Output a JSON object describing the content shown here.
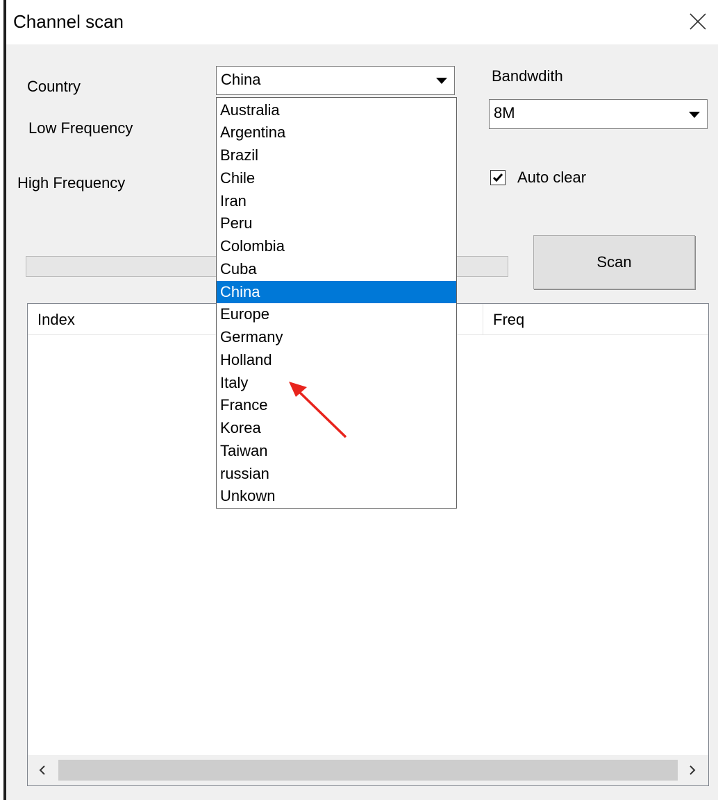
{
  "window": {
    "title": "Channel scan",
    "close_icon": "close-icon"
  },
  "form": {
    "country_label": "Country",
    "low_freq_label": "Low Frequency",
    "high_freq_label": "High Frequency",
    "bandwidth_label": "Bandwdith",
    "country_value": "China",
    "bandwidth_value": "8M",
    "auto_clear_label": "Auto clear",
    "auto_clear_checked": true,
    "scan_label": "Scan"
  },
  "country_dropdown": {
    "items": [
      "Australia",
      "Argentina",
      "Brazil",
      "Chile",
      "Iran",
      "Peru",
      "Colombia",
      "Cuba",
      "China",
      "Europe",
      "Germany",
      "Holland",
      "Italy",
      "France",
      "Korea",
      "Taiwan",
      "russian",
      "Unkown"
    ],
    "selected": "China"
  },
  "progress": {
    "value": 0
  },
  "table": {
    "columns": [
      "Index",
      "Freq"
    ],
    "rows": []
  },
  "annotation": {
    "color": "#e8241d",
    "points_to": "Italy"
  },
  "colors": {
    "selection": "#0078d7",
    "window_bg": "#f0f0f0"
  }
}
